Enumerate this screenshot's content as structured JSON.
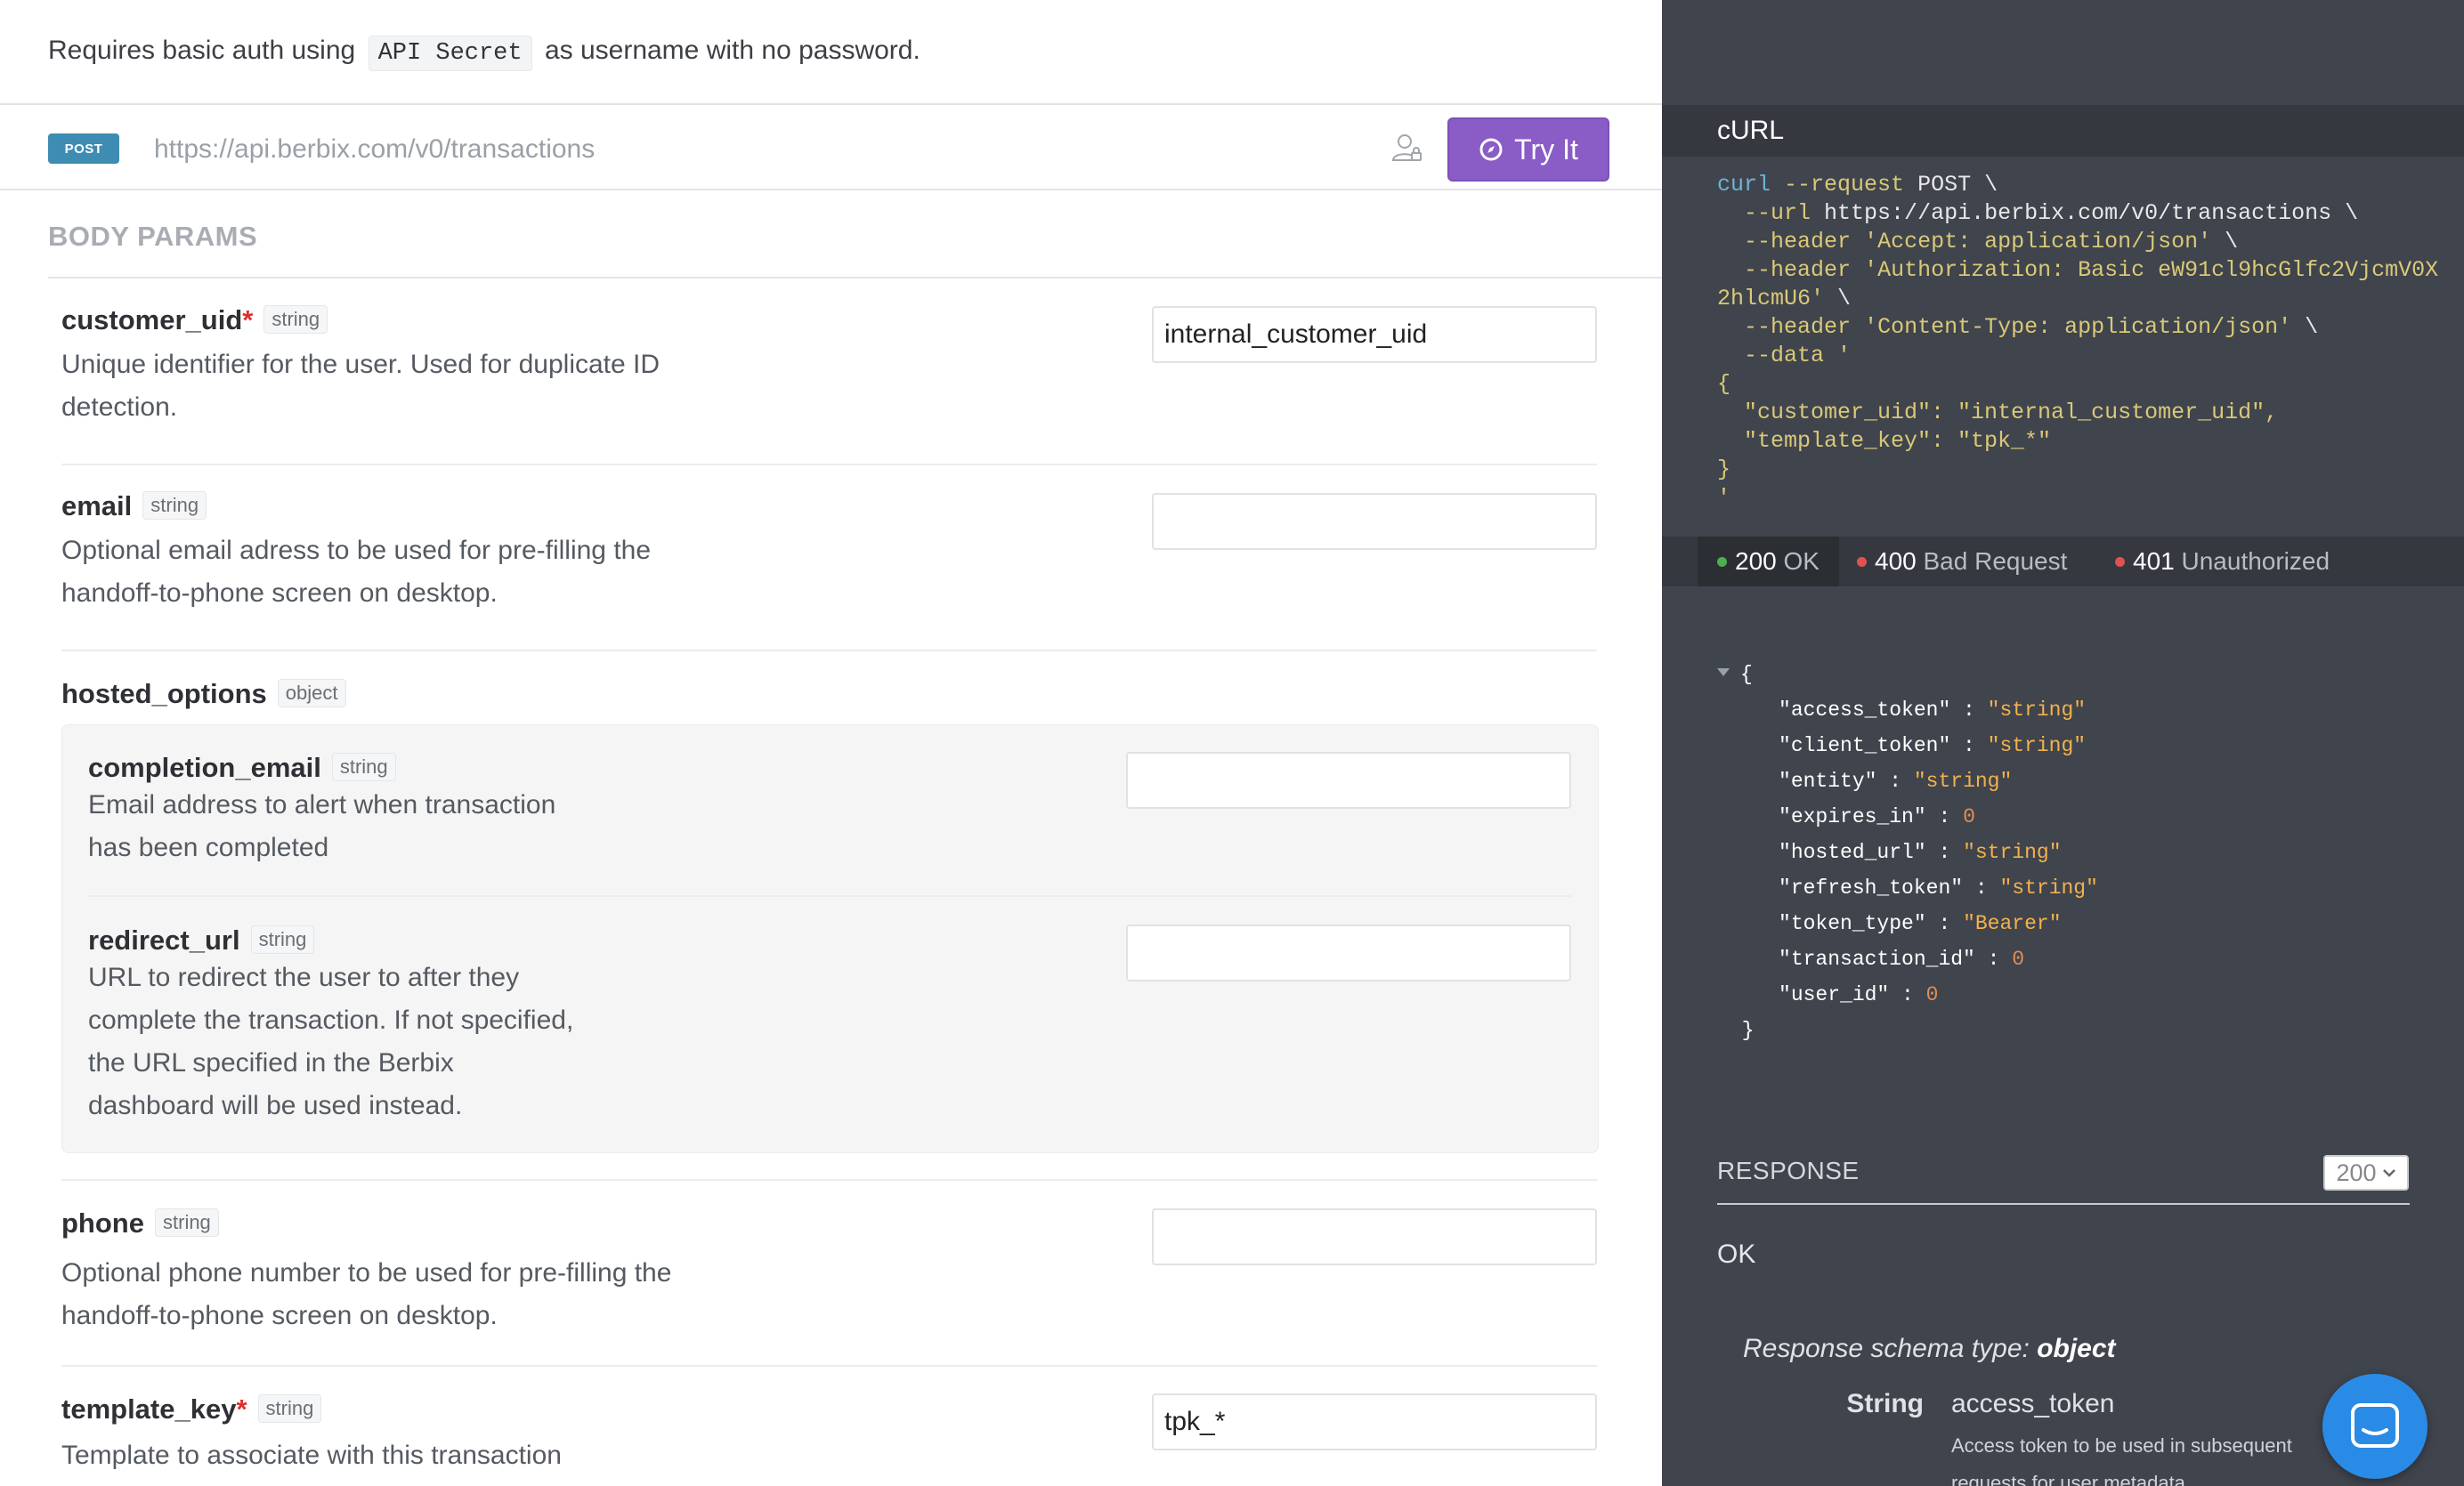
{
  "auth": {
    "prefix": "Requires basic auth using",
    "code": "API Secret",
    "suffix": "as username with no password."
  },
  "endpoint": {
    "method": "POST",
    "url": "https://api.berbix.com/v0/transactions",
    "try_label": "Try It"
  },
  "body_params": {
    "title": "BODY PARAMS",
    "customer_uid": {
      "name": "customer_uid",
      "required": "*",
      "type": "string",
      "desc": "Unique identifier for the user. Used for duplicate ID detection.",
      "value": "internal_customer_uid"
    },
    "email": {
      "name": "email",
      "type": "string",
      "desc": "Optional email adress to be used for pre-filling the handoff-to-phone screen on desktop.",
      "value": ""
    },
    "hosted_options": {
      "name": "hosted_options",
      "type": "object",
      "completion_email": {
        "name": "completion_email",
        "type": "string",
        "desc": "Email address to alert when transaction has been completed",
        "value": ""
      },
      "redirect_url": {
        "name": "redirect_url",
        "type": "string",
        "desc": "URL to redirect the user to after they complete the transaction. If not specified, the URL specified in the Berbix dashboard will be used instead.",
        "value": ""
      }
    },
    "phone": {
      "name": "phone",
      "type": "string",
      "desc": "Optional phone number to be used for pre-filling the handoff-to-phone screen on desktop.",
      "value": ""
    },
    "template_key": {
      "name": "template_key",
      "required": "*",
      "type": "string",
      "desc": "Template to associate with this transaction",
      "value": "tpk_*"
    }
  },
  "curl": {
    "title": "cURL",
    "l1_cmd": "curl",
    "l1_flag": "--request",
    "l1_val": "POST \\",
    "l2_flag": "--url",
    "l2_val": "https://api.berbix.com/v0/transactions \\",
    "l3_flag": "--header",
    "l3_val": "'Accept: application/json'",
    "l3_end": " \\",
    "l4_flag": "--header",
    "l4_val": "'Authorization: Basic eW91cl9hcGlfc2VjcmV0X",
    "l5_val": "2hlcmU6'",
    "l5_end": " \\",
    "l6_flag": "--header",
    "l6_val": "'Content-Type: application/json'",
    "l6_end": " \\",
    "l7_flag": "--data",
    "l7_val": "'",
    "l8": "{",
    "l9": "  \"customer_uid\": \"internal_customer_uid\",",
    "l10": "  \"template_key\": \"tpk_*\"",
    "l11": "}",
    "l12": "'"
  },
  "statuses": [
    {
      "code": "200",
      "label": "OK",
      "color": "#4caf50"
    },
    {
      "code": "400",
      "label": "Bad Request",
      "color": "#e05252"
    },
    {
      "code": "401",
      "label": "Unauthorized",
      "color": "#e05252"
    }
  ],
  "response_json": {
    "open": "{",
    "close": "}",
    "fields": [
      {
        "key": "\"access_token\"",
        "val": "\"string\"",
        "kind": "str"
      },
      {
        "key": "\"client_token\"",
        "val": "\"string\"",
        "kind": "str"
      },
      {
        "key": "\"entity\"",
        "val": "\"string\"",
        "kind": "str"
      },
      {
        "key": "\"expires_in\"",
        "val": "0",
        "kind": "num"
      },
      {
        "key": "\"hosted_url\"",
        "val": "\"string\"",
        "kind": "str"
      },
      {
        "key": "\"refresh_token\"",
        "val": "\"string\"",
        "kind": "str"
      },
      {
        "key": "\"token_type\"",
        "val": "\"Bearer\"",
        "kind": "str"
      },
      {
        "key": "\"transaction_id\"",
        "val": "0",
        "kind": "num"
      },
      {
        "key": "\"user_id\"",
        "val": "0",
        "kind": "num"
      }
    ]
  },
  "response": {
    "label": "RESPONSE",
    "selected": "200",
    "status_text": "OK",
    "schema_prefix": "Response schema type:",
    "schema_type": "object",
    "field_type": "String",
    "field_name": "access_token",
    "field_desc": "Access token to be used in subsequent requests for user metadata"
  },
  "colors": {
    "accent": "#8a5cc6",
    "badge": "#3f8cb2",
    "panel": "#40444d",
    "chat": "#2a8be6"
  }
}
